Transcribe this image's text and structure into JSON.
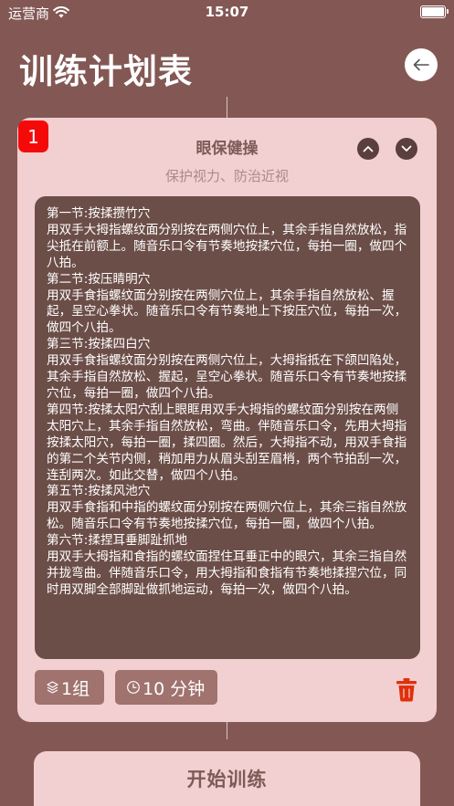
{
  "status_bar": {
    "carrier": "运营商",
    "time": "15:07"
  },
  "header": {
    "title": "训练计划表"
  },
  "card": {
    "badge": "1",
    "title": "眼保健操",
    "subtitle": "保护视力、防治近视",
    "content": "第一节:按揉攒竹穴\n用双手大拇指螺纹面分别按在两侧穴位上，其余手指自然放松，指尖抵在前额上。随音乐口令有节奏地按揉穴位，每拍一圈，做四个八拍。\n第二节:按压睛明穴\n用双手食指螺纹面分别按在两侧穴位上，其余手指自然放松、握起，呈空心拳状。随音乐口令有节奏地上下按压穴位，每拍一次，做四个八拍。\n第三节:按揉四白穴\n用双手食指螺纹面分别按在两侧穴位上，大拇指抵在下颌凹陷处，其余手指自然放松、握起，呈空心拳状。随音乐口令有节奏地按揉穴位，每拍一圈，做四个八拍。\n第四节:按揉太阳穴刮上眼眶用双手大拇指的螺纹面分别按在两侧太阳穴上，其余手指自然放松，弯曲。伴随音乐口令，先用大拇指按揉太阳穴，每拍一圈，揉四圈。然后，大拇指不动，用双手食指的第二个关节内侧，稍加用力从眉头刮至眉梢，两个节拍刮一次，连刮两次。如此交替，做四个八拍。\n第五节:按揉风池穴\n用双手食指和中指的螺纹面分别按在两侧穴位上，其余三指自然放松。随音乐口令有节奏地按揉穴位，每拍一圈，做四个八拍。\n第六节:揉捏耳垂脚趾抓地\n用双手大拇指和食指的螺纹面捏住耳垂正中的眼穴，其余三指自然并拢弯曲。伴随音乐口令，用大拇指和食指有节奏地揉捏穴位，同时用双脚全部脚趾做抓地运动，每拍一次，做四个八拍。",
    "sets_label": "1组",
    "duration_label": "10 分钟"
  },
  "footer": {
    "start_label": "开始训练"
  },
  "colors": {
    "background": "#835854",
    "card": "#f2cfd0",
    "content_box": "#6c4e48",
    "chip": "#a0736f",
    "badge": "#f50a0a",
    "delete": "#e0300c"
  },
  "icons": {
    "back": "back-arrow-icon",
    "up": "chevron-up-icon",
    "down": "chevron-down-icon",
    "sets": "layers-icon",
    "duration": "clock-icon",
    "delete": "trash-icon"
  }
}
